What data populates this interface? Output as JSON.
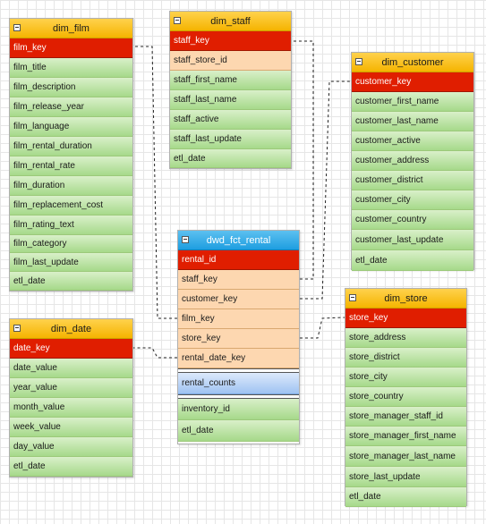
{
  "tables": {
    "dim_film": {
      "title": "dim_film",
      "key": "film_key",
      "fields": [
        "film_title",
        "film_description",
        "film_release_year",
        "film_language",
        "film_rental_duration",
        "film_rental_rate",
        "film_duration",
        "film_replacement_cost",
        "film_rating_text",
        "film_category",
        "film_last_update",
        "etl_date"
      ]
    },
    "dim_staff": {
      "title": "dim_staff",
      "key": "staff_key",
      "highlight": "staff_store_id",
      "fields": [
        "staff_first_name",
        "staff_last_name",
        "staff_active",
        "staff_last_update",
        "etl_date"
      ]
    },
    "dim_customer": {
      "title": "dim_customer",
      "key": "customer_key",
      "fields": [
        "customer_first_name",
        "customer_last_name",
        "customer_active",
        "customer_address",
        "customer_district",
        "customer_city",
        "customer_country",
        "customer_last_update",
        "etl_date"
      ]
    },
    "dwd_fct_rental": {
      "title": "dwd_fct_rental",
      "key": "rental_id",
      "foreign_keys": [
        "staff_key",
        "customer_key",
        "film_key",
        "store_key",
        "rental_date_key"
      ],
      "measure": "rental_counts",
      "fields": [
        "inventory_id",
        "etl_date"
      ]
    },
    "dim_date": {
      "title": "dim_date",
      "key": "date_key",
      "fields": [
        "date_value",
        "year_value",
        "month_value",
        "week_value",
        "day_value",
        "etl_date"
      ]
    },
    "dim_store": {
      "title": "dim_store",
      "key": "store_key",
      "fields": [
        "store_address",
        "store_district",
        "store_city",
        "store_country",
        "store_manager_staff_id",
        "store_manager_first_name",
        "store_manager_last_name",
        "store_last_update",
        "etl_date"
      ]
    }
  },
  "relationships": [
    {
      "from": "dwd_fct_rental.staff_key",
      "to": "dim_staff.staff_key"
    },
    {
      "from": "dwd_fct_rental.customer_key",
      "to": "dim_customer.customer_key"
    },
    {
      "from": "dwd_fct_rental.film_key",
      "to": "dim_film.film_key"
    },
    {
      "from": "dwd_fct_rental.store_key",
      "to": "dim_store.store_key"
    },
    {
      "from": "dwd_fct_rental.rental_date_key",
      "to": "dim_date.date_key"
    }
  ]
}
